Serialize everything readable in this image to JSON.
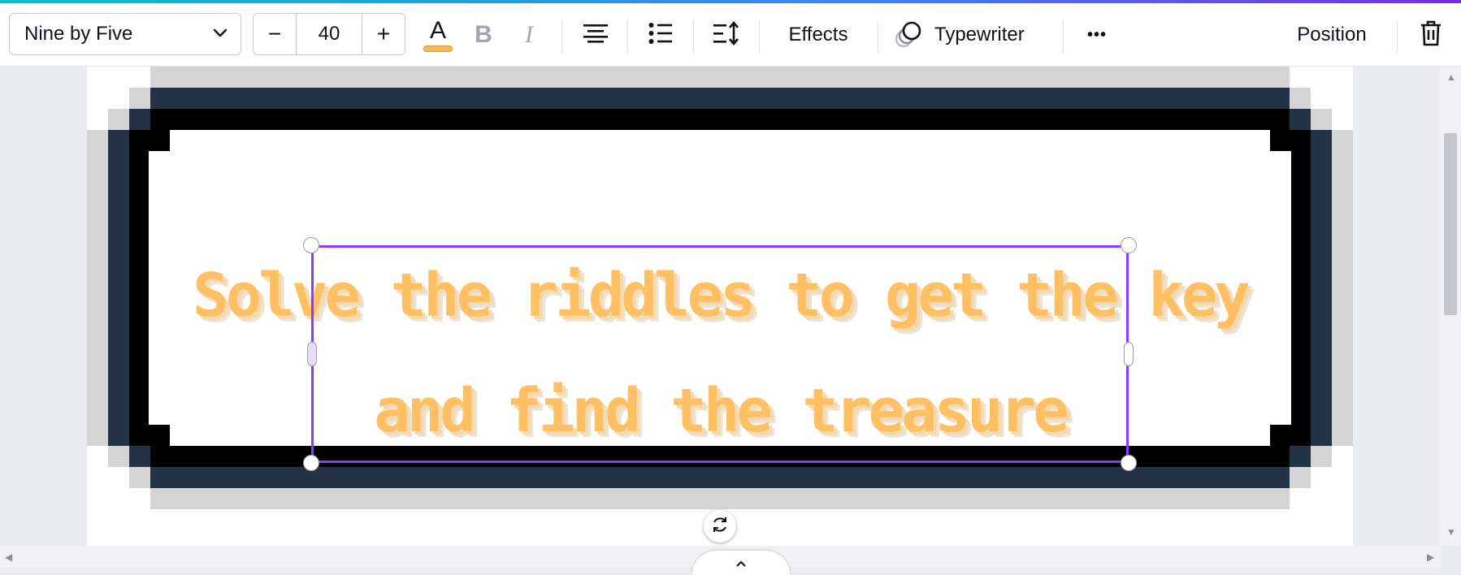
{
  "toolbar": {
    "font_family": "Nine by Five",
    "font_size_decrease": "−",
    "font_size": "40",
    "font_size_increase": "+",
    "text_color_glyph": "A",
    "text_color_swatch": "#f7b955",
    "bold_glyph": "B",
    "italic_glyph": "I",
    "effects_label": "Effects",
    "animation_label": "Typewriter",
    "more_glyph": "•••",
    "position_label": "Position",
    "icons": {
      "font_dropdown": "chevron-down-icon",
      "alignment": "align-center-icon",
      "list": "bulleted-list-icon",
      "spacing": "line-spacing-icon",
      "animation": "animate-icon",
      "delete": "trash-icon"
    }
  },
  "canvas": {
    "text_line_1": "Solve the riddles to get the key",
    "text_line_2": "and find the treasure",
    "text_color": "#ffc064",
    "selection_color": "#8b3dff",
    "frame_colors": [
      "#d4d4d4",
      "#233345",
      "#000000"
    ],
    "rotate_icon": "rotate-icon"
  },
  "scrollbars": {
    "up_arrow": "▲",
    "down_arrow": "▼",
    "left_arrow": "◀",
    "right_arrow": "▶",
    "page_toggle": "chevron-up-icon"
  }
}
